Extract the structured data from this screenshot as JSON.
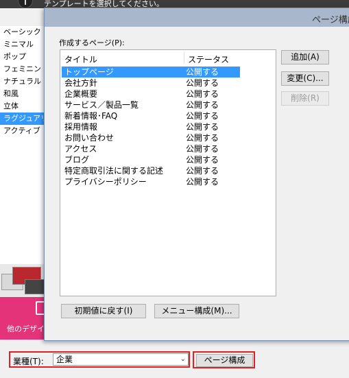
{
  "window": {
    "instruction": "テンプレートを選択してください。"
  },
  "categories": {
    "items": [
      "ベーシック",
      "ミニマル",
      "ポップ",
      "フェミニン",
      "ナチュラル",
      "和風",
      "立体",
      "ラグジュアリー",
      "アクティブ"
    ],
    "selected_index": 7
  },
  "promo": {
    "label": "他のデザインをさがす"
  },
  "bottom": {
    "business_label": "業種(T):",
    "business_value": "企業",
    "page_config_button": "ページ構成"
  },
  "dialog": {
    "title": "ページ構成",
    "list_label": "作成するページ(P):",
    "columns": [
      "タイトル",
      "ステータス"
    ],
    "rows": [
      {
        "title": "トップページ",
        "status": "公開する"
      },
      {
        "title": "会社方針",
        "status": "公開する"
      },
      {
        "title": "企業概要",
        "status": "公開する"
      },
      {
        "title": "サービス／製品一覧",
        "status": "公開する"
      },
      {
        "title": "新着情報･FAQ",
        "status": "公開する"
      },
      {
        "title": "採用情報",
        "status": "公開する"
      },
      {
        "title": "お問い合わせ",
        "status": "公開する"
      },
      {
        "title": "アクセス",
        "status": "公開する"
      },
      {
        "title": "ブログ",
        "status": "公開する"
      },
      {
        "title": "特定商取引法に関する記述",
        "status": "公開する"
      },
      {
        "title": "プライバシーポリシー",
        "status": "公開する"
      }
    ],
    "selected_row": 0,
    "buttons": {
      "add": "追加(A)",
      "edit": "変更(C)...",
      "delete": "削除(R)",
      "reset": "初期値に戻す(I)",
      "menu": "メニュー構成(M)..."
    }
  },
  "colors": {
    "selection": "#3399ff",
    "highlight_border": "#e02020",
    "promo": "#e5337a"
  }
}
